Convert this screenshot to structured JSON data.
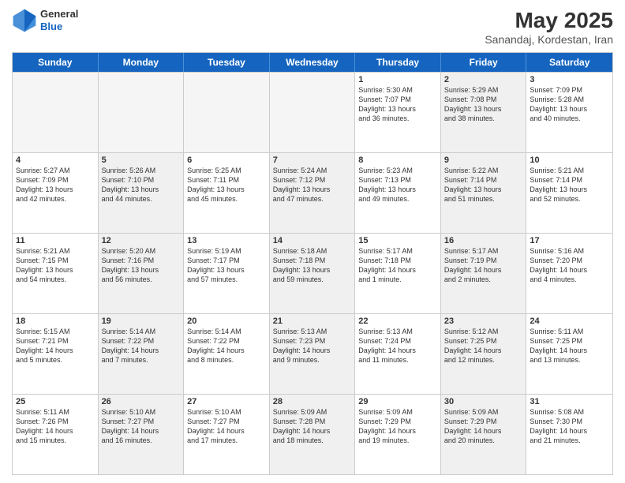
{
  "header": {
    "logo_general": "General",
    "logo_blue": "Blue",
    "month_year": "May 2025",
    "location": "Sanandaj, Kordestan, Iran"
  },
  "weekdays": [
    "Sunday",
    "Monday",
    "Tuesday",
    "Wednesday",
    "Thursday",
    "Friday",
    "Saturday"
  ],
  "rows": [
    [
      {
        "day": "",
        "text": "",
        "empty": true
      },
      {
        "day": "",
        "text": "",
        "empty": true
      },
      {
        "day": "",
        "text": "",
        "empty": true
      },
      {
        "day": "",
        "text": "",
        "empty": true
      },
      {
        "day": "1",
        "text": "Sunrise: 5:30 AM\nSunset: 7:07 PM\nDaylight: 13 hours\nand 36 minutes."
      },
      {
        "day": "2",
        "text": "Sunrise: 5:29 AM\nSunset: 7:08 PM\nDaylight: 13 hours\nand 38 minutes.",
        "shaded": true
      },
      {
        "day": "3",
        "text": "Sunset: 7:09 PM\nSunrise: 5:28 AM\nDaylight: 13 hours\nand 40 minutes."
      }
    ],
    [
      {
        "day": "4",
        "text": "Sunrise: 5:27 AM\nSunset: 7:09 PM\nDaylight: 13 hours\nand 42 minutes."
      },
      {
        "day": "5",
        "text": "Sunrise: 5:26 AM\nSunset: 7:10 PM\nDaylight: 13 hours\nand 44 minutes.",
        "shaded": true
      },
      {
        "day": "6",
        "text": "Sunrise: 5:25 AM\nSunset: 7:11 PM\nDaylight: 13 hours\nand 45 minutes."
      },
      {
        "day": "7",
        "text": "Sunrise: 5:24 AM\nSunset: 7:12 PM\nDaylight: 13 hours\nand 47 minutes.",
        "shaded": true
      },
      {
        "day": "8",
        "text": "Sunrise: 5:23 AM\nSunset: 7:13 PM\nDaylight: 13 hours\nand 49 minutes."
      },
      {
        "day": "9",
        "text": "Sunrise: 5:22 AM\nSunset: 7:14 PM\nDaylight: 13 hours\nand 51 minutes.",
        "shaded": true
      },
      {
        "day": "10",
        "text": "Sunrise: 5:21 AM\nSunset: 7:14 PM\nDaylight: 13 hours\nand 52 minutes."
      }
    ],
    [
      {
        "day": "11",
        "text": "Sunrise: 5:21 AM\nSunset: 7:15 PM\nDaylight: 13 hours\nand 54 minutes."
      },
      {
        "day": "12",
        "text": "Sunrise: 5:20 AM\nSunset: 7:16 PM\nDaylight: 13 hours\nand 56 minutes.",
        "shaded": true
      },
      {
        "day": "13",
        "text": "Sunrise: 5:19 AM\nSunset: 7:17 PM\nDaylight: 13 hours\nand 57 minutes."
      },
      {
        "day": "14",
        "text": "Sunrise: 5:18 AM\nSunset: 7:18 PM\nDaylight: 13 hours\nand 59 minutes.",
        "shaded": true
      },
      {
        "day": "15",
        "text": "Sunrise: 5:17 AM\nSunset: 7:18 PM\nDaylight: 14 hours\nand 1 minute."
      },
      {
        "day": "16",
        "text": "Sunrise: 5:17 AM\nSunset: 7:19 PM\nDaylight: 14 hours\nand 2 minutes.",
        "shaded": true
      },
      {
        "day": "17",
        "text": "Sunrise: 5:16 AM\nSunset: 7:20 PM\nDaylight: 14 hours\nand 4 minutes."
      }
    ],
    [
      {
        "day": "18",
        "text": "Sunrise: 5:15 AM\nSunset: 7:21 PM\nDaylight: 14 hours\nand 5 minutes."
      },
      {
        "day": "19",
        "text": "Sunrise: 5:14 AM\nSunset: 7:22 PM\nDaylight: 14 hours\nand 7 minutes.",
        "shaded": true
      },
      {
        "day": "20",
        "text": "Sunrise: 5:14 AM\nSunset: 7:22 PM\nDaylight: 14 hours\nand 8 minutes."
      },
      {
        "day": "21",
        "text": "Sunrise: 5:13 AM\nSunset: 7:23 PM\nDaylight: 14 hours\nand 9 minutes.",
        "shaded": true
      },
      {
        "day": "22",
        "text": "Sunrise: 5:13 AM\nSunset: 7:24 PM\nDaylight: 14 hours\nand 11 minutes."
      },
      {
        "day": "23",
        "text": "Sunrise: 5:12 AM\nSunset: 7:25 PM\nDaylight: 14 hours\nand 12 minutes.",
        "shaded": true
      },
      {
        "day": "24",
        "text": "Sunrise: 5:11 AM\nSunset: 7:25 PM\nDaylight: 14 hours\nand 13 minutes."
      }
    ],
    [
      {
        "day": "25",
        "text": "Sunrise: 5:11 AM\nSunset: 7:26 PM\nDaylight: 14 hours\nand 15 minutes."
      },
      {
        "day": "26",
        "text": "Sunrise: 5:10 AM\nSunset: 7:27 PM\nDaylight: 14 hours\nand 16 minutes.",
        "shaded": true
      },
      {
        "day": "27",
        "text": "Sunrise: 5:10 AM\nSunset: 7:27 PM\nDaylight: 14 hours\nand 17 minutes."
      },
      {
        "day": "28",
        "text": "Sunrise: 5:09 AM\nSunset: 7:28 PM\nDaylight: 14 hours\nand 18 minutes.",
        "shaded": true
      },
      {
        "day": "29",
        "text": "Sunrise: 5:09 AM\nSunset: 7:29 PM\nDaylight: 14 hours\nand 19 minutes."
      },
      {
        "day": "30",
        "text": "Sunrise: 5:09 AM\nSunset: 7:29 PM\nDaylight: 14 hours\nand 20 minutes.",
        "shaded": true
      },
      {
        "day": "31",
        "text": "Sunrise: 5:08 AM\nSunset: 7:30 PM\nDaylight: 14 hours\nand 21 minutes."
      }
    ]
  ]
}
